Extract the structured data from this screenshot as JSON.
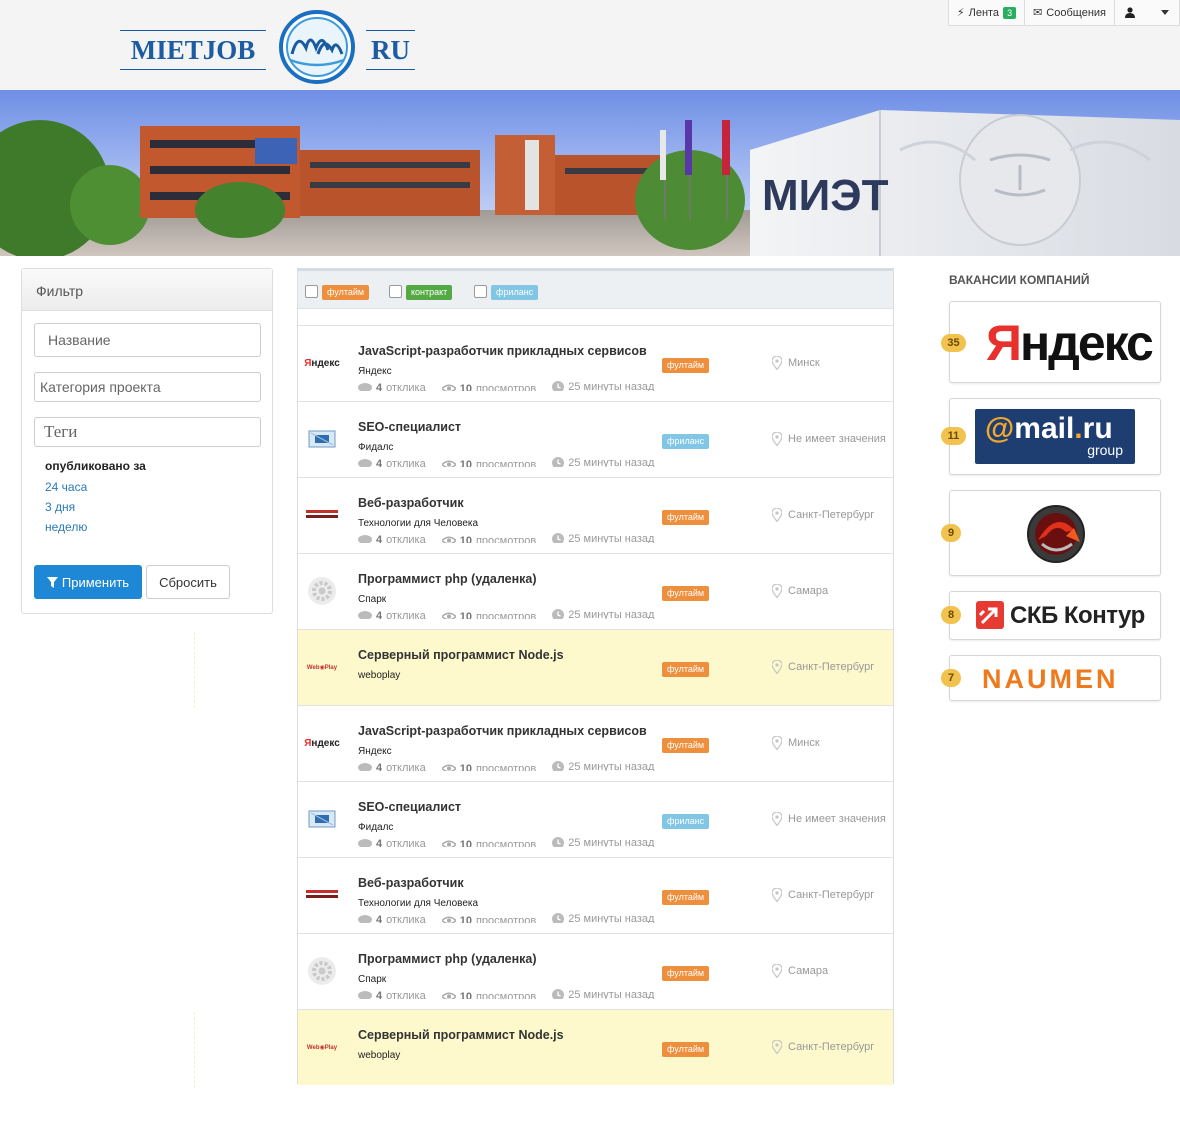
{
  "header": {
    "logo_left": "MIETJOB",
    "logo_right": "RU",
    "nav": {
      "feed_label": "Лента",
      "feed_count": "3",
      "messages_label": "Сообщения"
    }
  },
  "banner": {
    "sign_text": "МИЭТ"
  },
  "filter": {
    "title": "Фильтр",
    "name_placeholder": "Название",
    "category_placeholder": "Категория проекта",
    "tags_placeholder": "Теги",
    "published_title": "опубликовано за",
    "periods": [
      "24 часа",
      "3 дня",
      "неделю"
    ],
    "apply_label": "Применить",
    "reset_label": "Сбросить"
  },
  "types": {
    "fulltime": "фултайм",
    "contract": "контракт",
    "freelance": "фриланс"
  },
  "jobs": [
    {
      "title": "JavaScript-разработчик прикладных сервисов",
      "company": "Яндекс",
      "tag": "фултайм",
      "tag_kind": "full",
      "city": "Минск",
      "replies": "4",
      "replies_label": "отклика",
      "views": "10",
      "views_label": "просмотров",
      "time": "25 минуты назад",
      "logo": "yandex",
      "highlight": false
    },
    {
      "title": "SEO-специалист",
      "company": "Фидалс",
      "tag": "фриланс",
      "tag_kind": "free",
      "city": "Не имеет значения",
      "replies": "4",
      "replies_label": "отклика",
      "views": "10",
      "views_label": "просмотров",
      "time": "25 минуты назад",
      "logo": "fidals",
      "highlight": false
    },
    {
      "title": "Веб-разработчик",
      "company": "Технологии для Человека",
      "tag": "фултайм",
      "tag_kind": "full",
      "city": "Санкт-Петербург",
      "replies": "4",
      "replies_label": "отклика",
      "views": "10",
      "views_label": "просмотров",
      "time": "25 минуты назад",
      "logo": "tech",
      "highlight": false
    },
    {
      "title": "Программист php (удаленка)",
      "company": "Спарк",
      "tag": "фултайм",
      "tag_kind": "full",
      "city": "Самара",
      "replies": "4",
      "replies_label": "отклика",
      "views": "10",
      "views_label": "просмотров",
      "time": "25 минуты назад",
      "logo": "gear",
      "highlight": false
    },
    {
      "title": "Серверный программист Node.js",
      "company": "weboplay",
      "tag": "фултайм",
      "tag_kind": "full",
      "city": "Санкт-Петербург",
      "replies": "",
      "replies_label": "",
      "views": "",
      "views_label": "",
      "time": "",
      "logo": "weboplay",
      "highlight": true
    },
    {
      "title": "JavaScript-разработчик прикладных сервисов",
      "company": "Яндекс",
      "tag": "фултайм",
      "tag_kind": "full",
      "city": "Минск",
      "replies": "4",
      "replies_label": "отклика",
      "views": "10",
      "views_label": "просмотров",
      "time": "25 минуты назад",
      "logo": "yandex",
      "highlight": false
    },
    {
      "title": "SEO-специалист",
      "company": "Фидалс",
      "tag": "фриланс",
      "tag_kind": "free",
      "city": "Не имеет значения",
      "replies": "4",
      "replies_label": "отклика",
      "views": "10",
      "views_label": "просмотров",
      "time": "25 минуты назад",
      "logo": "fidals",
      "highlight": false
    },
    {
      "title": "Веб-разработчик",
      "company": "Технологии для Человека",
      "tag": "фултайм",
      "tag_kind": "full",
      "city": "Санкт-Петербург",
      "replies": "4",
      "replies_label": "отклика",
      "views": "10",
      "views_label": "просмотров",
      "time": "25 минуты назад",
      "logo": "tech",
      "highlight": false
    },
    {
      "title": "Программист php (удаленка)",
      "company": "Спарк",
      "tag": "фултайм",
      "tag_kind": "full",
      "city": "Самара",
      "replies": "4",
      "replies_label": "отклика",
      "views": "10",
      "views_label": "просмотров",
      "time": "25 минуты назад",
      "logo": "gear",
      "highlight": false
    },
    {
      "title": "Серверный программист Node.js",
      "company": "weboplay",
      "tag": "фултайм",
      "tag_kind": "full",
      "city": "Санкт-Петербург",
      "replies": "",
      "replies_label": "",
      "views": "",
      "views_label": "",
      "time": "",
      "logo": "weboplay",
      "highlight": true
    }
  ],
  "companies": {
    "title": "ВАКАНСИИ КОМПАНИЙ",
    "items": [
      {
        "name": "Яндекс",
        "count": "35"
      },
      {
        "name": "@mail.ru group",
        "count": "11"
      },
      {
        "name": "World of Tanks",
        "count": "9"
      },
      {
        "name": "СКБ Контур",
        "count": "8"
      },
      {
        "name": "NAUMEN",
        "count": "7"
      }
    ]
  }
}
